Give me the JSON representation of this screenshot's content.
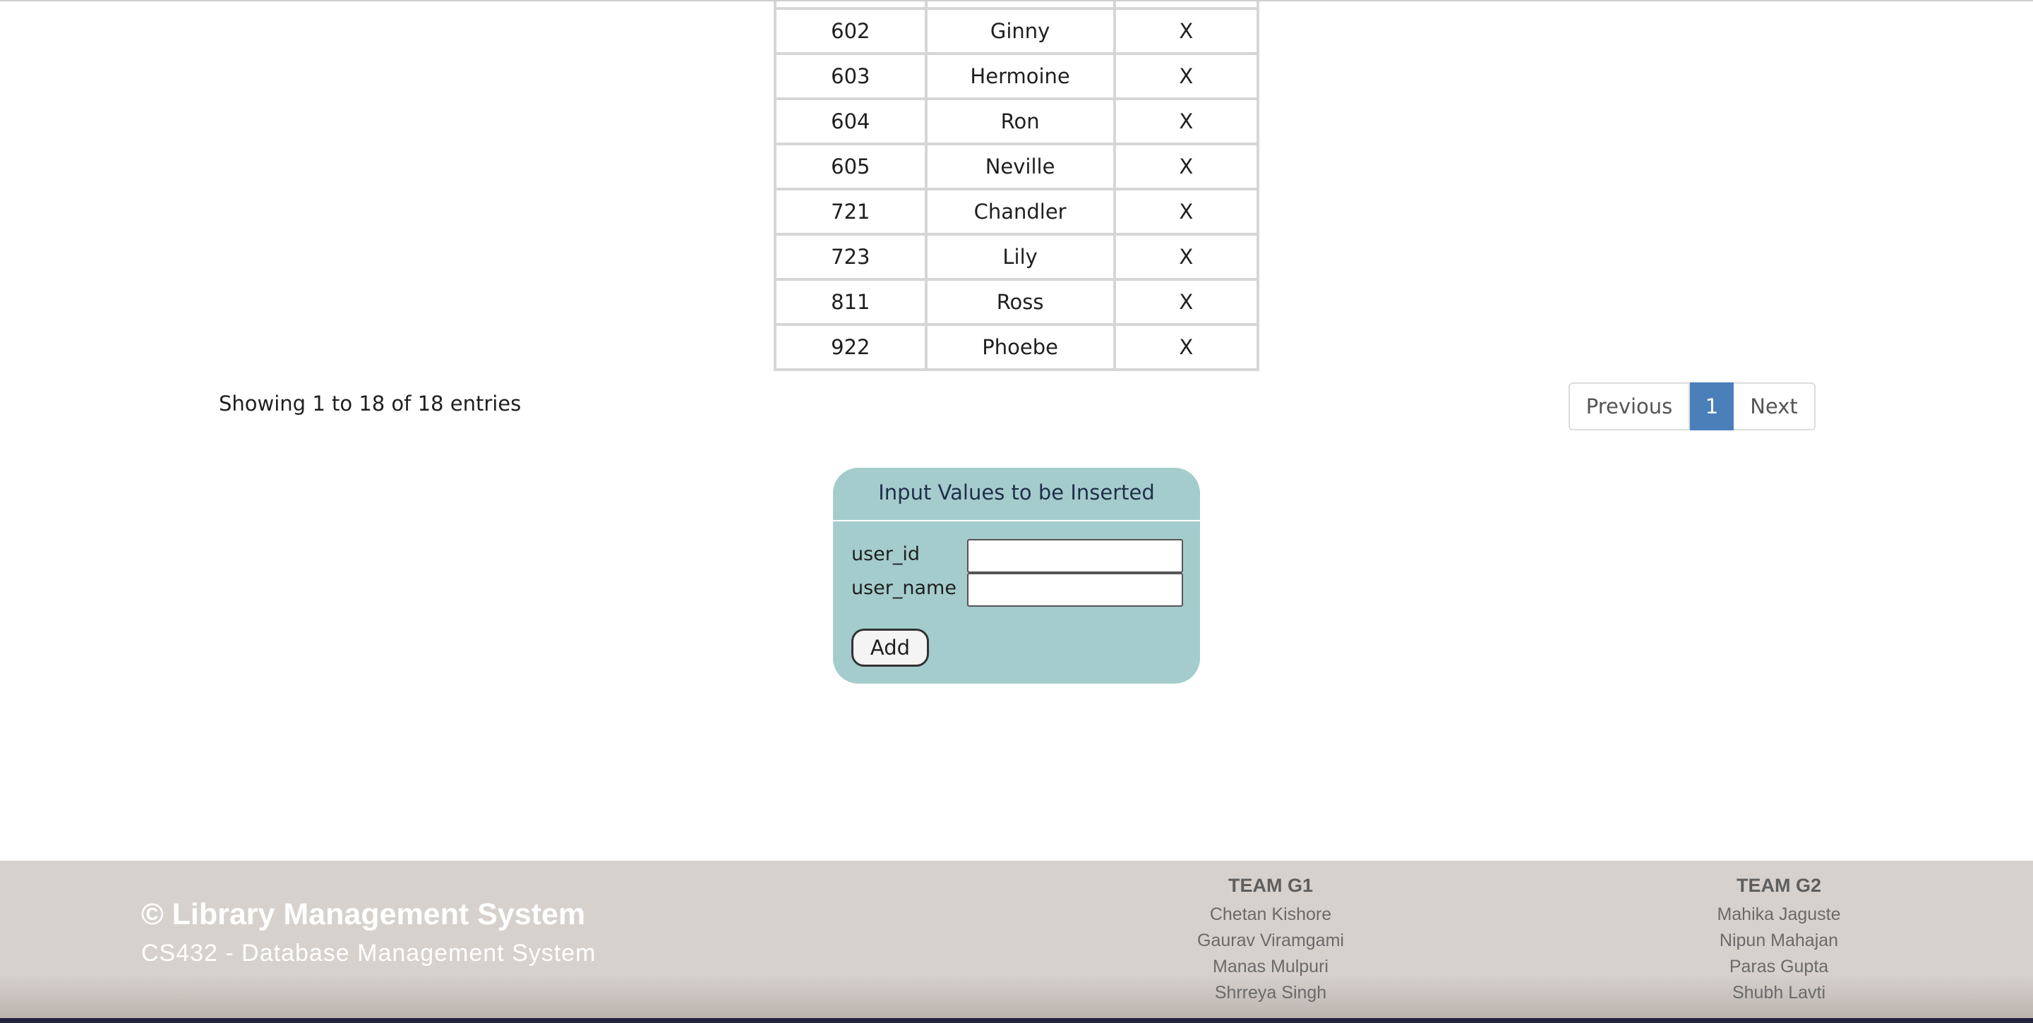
{
  "table": {
    "rows": [
      {
        "id": "602",
        "name": "Ginny",
        "delete": "X"
      },
      {
        "id": "603",
        "name": "Hermoine",
        "delete": "X"
      },
      {
        "id": "604",
        "name": "Ron",
        "delete": "X"
      },
      {
        "id": "605",
        "name": "Neville",
        "delete": "X"
      },
      {
        "id": "721",
        "name": "Chandler",
        "delete": "X"
      },
      {
        "id": "723",
        "name": "Lily",
        "delete": "X"
      },
      {
        "id": "811",
        "name": "Ross",
        "delete": "X"
      },
      {
        "id": "922",
        "name": "Phoebe",
        "delete": "X"
      }
    ]
  },
  "table_info": {
    "entries_text": "Showing 1 to 18 of 18 entries"
  },
  "pagination": {
    "previous_label": "Previous",
    "current_page": "1",
    "next_label": "Next",
    "active_color": "#4a7fb9"
  },
  "insert_form": {
    "title": "Input Values to be Inserted",
    "fields": [
      {
        "label": "user_id",
        "value": ""
      },
      {
        "label": "user_name",
        "value": ""
      }
    ],
    "add_label": "Add",
    "background_color": "#a5cccd"
  },
  "footer": {
    "brand_title": "© Library Management System",
    "brand_subtitle": "CS432 - Database Management System",
    "teams": [
      {
        "name": "TEAM G1",
        "members": [
          "Chetan Kishore",
          "Gaurav Viramgami",
          "Manas Mulpuri",
          "Shrreya Singh"
        ]
      },
      {
        "name": "TEAM G2",
        "members": [
          "Mahika Jaguste",
          "Nipun Mahajan",
          "Paras Gupta",
          "Shubh Lavti"
        ]
      }
    ],
    "background_color": "#d7d1cd"
  }
}
